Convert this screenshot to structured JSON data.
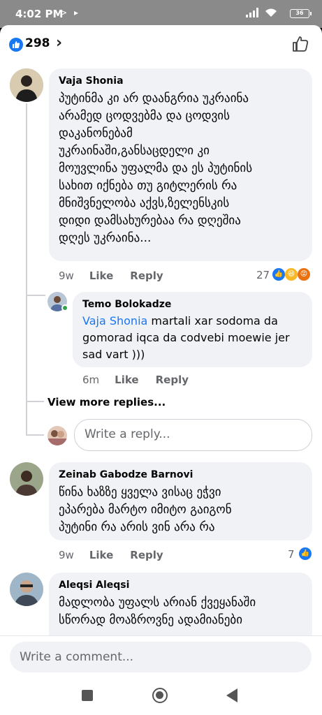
{
  "status_bar": {
    "time": "4:02 PM",
    "battery": "36"
  },
  "reactions": {
    "count": "298"
  },
  "comments": [
    {
      "author": "Vaja Shonia",
      "text": "პუტინმა კი არ დაანგრია უკრაინა\nარამედ ცოდვებმა და ცოდვის\nდაკანონებამ\nუკრაინაში,განსაცდელი კი\nმოუვლინა უფალმა და ეს პუტინის\nსახით იქნება თუ გიტლერის რა\nმნიშვნელობა აქვს,ზელენსკის\nდიდი დამსახურებაა რა დღეშია\nდღეს  უკრაინა...",
      "time": "9w",
      "like": "Like",
      "reply": "Reply",
      "reaction_count": "27"
    },
    {
      "author": "Zeinab Gabodze Barnovi",
      "text": "წინა ხაზზე ყველა ვისაც ეჭვი\nეპარება მარტო იმიტო გაიგონ\nპუტინი რა არის ვინ არა რა",
      "time": "9w",
      "like": "Like",
      "reply": "Reply",
      "reaction_count": "7"
    },
    {
      "author": "Aleqsi Aleqsi",
      "text": "მადლობა უფალს არიან ქვეყანაში\nსწორად მოაზროვნე ადამიანები"
    }
  ],
  "reply": {
    "author": "Temo Bolokadze",
    "mention": "Vaja Shonia",
    "text": "martali xar sodoma da\ngomorad iqca da codvebi moewie jer\nsad vart )))",
    "time": "6m",
    "like": "Like",
    "reply": "Reply"
  },
  "view_more_replies": "View more replies...",
  "reply_input_placeholder": "Write a reply...",
  "comment_input_placeholder": "Write a comment...",
  "colors": {
    "accent": "#1877f2",
    "bubble": "#f0f2f5",
    "muted": "#65676b"
  },
  "icons": [
    "like-icon",
    "haha-icon",
    "angry-icon",
    "chevron-right-icon",
    "thumbs-up-outline-icon",
    "stop-square-icon",
    "home-circle-icon",
    "back-triangle-icon"
  ]
}
